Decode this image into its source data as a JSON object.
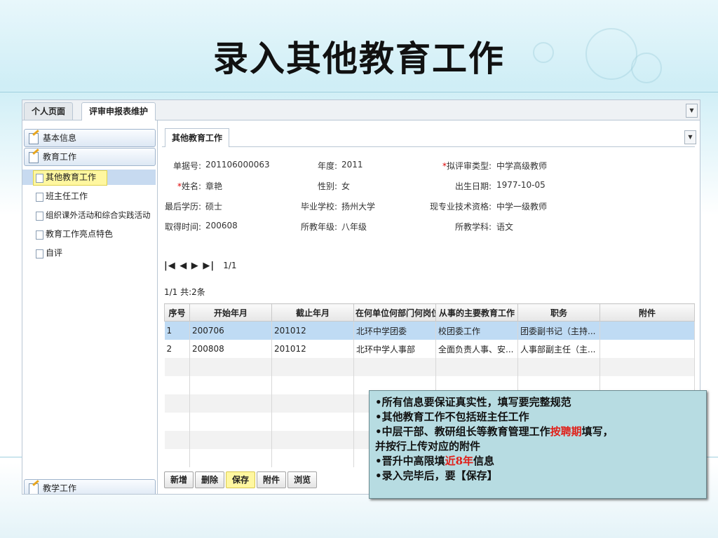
{
  "slide_title": "录入其他教育工作",
  "top_tabs": [
    "个人页面",
    "评审申报表维护"
  ],
  "sidebar": {
    "panel_basic": "基本信息",
    "panel_teaching": "教育工作",
    "items": [
      "其他教育工作",
      "班主任工作",
      "组织课外活动和综合实践活动",
      "教育工作亮点特色",
      "自评"
    ],
    "selected_item": "其他教育工作",
    "panel_bottom": "教学工作"
  },
  "form": {
    "tab": "其他教育工作",
    "fields": [
      {
        "label": "单据号:",
        "value": "201106000063",
        "required": false
      },
      {
        "label": "年度:",
        "value": "2011",
        "required": false
      },
      {
        "label": "拟评审类型:",
        "value": "中学高级教师",
        "required": true
      },
      {
        "label": "姓名:",
        "value": "章艳",
        "required": true
      },
      {
        "label": "性别:",
        "value": "女",
        "required": false
      },
      {
        "label": "出生日期:",
        "value": "1977-10-05",
        "required": false
      },
      {
        "label": "最后学历:",
        "value": "硕士",
        "required": false
      },
      {
        "label": "毕业学校:",
        "value": "扬州大学",
        "required": false
      },
      {
        "label": "现专业技术资格:",
        "value": "中学一级教师",
        "required": false
      },
      {
        "label": "取得时间:",
        "value": "200608",
        "required": false
      },
      {
        "label": "所教年级:",
        "value": "八年级",
        "required": false
      },
      {
        "label": "所教学科:",
        "value": "语文",
        "required": false
      }
    ]
  },
  "pager": {
    "nav": "|◀ ◀ ▶ ▶|",
    "page": "1/1",
    "count": "1/1 共:2条"
  },
  "grid": {
    "headers": [
      "序号",
      "开始年月",
      "截止年月",
      "在何单位何部门何岗位",
      "从事的主要教育工作",
      "职务",
      "附件"
    ],
    "rows": [
      [
        "1",
        "200706",
        "201012",
        "北环中学团委",
        "校团委工作",
        "团委副书记（主持...",
        ""
      ],
      [
        "2",
        "200808",
        "201012",
        "北环中学人事部",
        "全面负责人事、安...",
        "人事部副主任（主...",
        ""
      ]
    ]
  },
  "toolbar": [
    "新增",
    "删除",
    "保存",
    "附件",
    "浏览"
  ],
  "note": {
    "line1": "•所有信息要保证真实性，填写要完整规范",
    "line2": "•其他教育工作不包括班主任工作",
    "line3_pre": "•中层干部、教研组长等教育管理工作",
    "line3_em": "按聘期",
    "line3_post": "填写，",
    "line4": "并按行上传对应的附件",
    "line5_pre": "•晋升中高限填",
    "line5_em": "近8年",
    "line5_post": "信息",
    "line6": "•录入完毕后，要【保存】"
  }
}
